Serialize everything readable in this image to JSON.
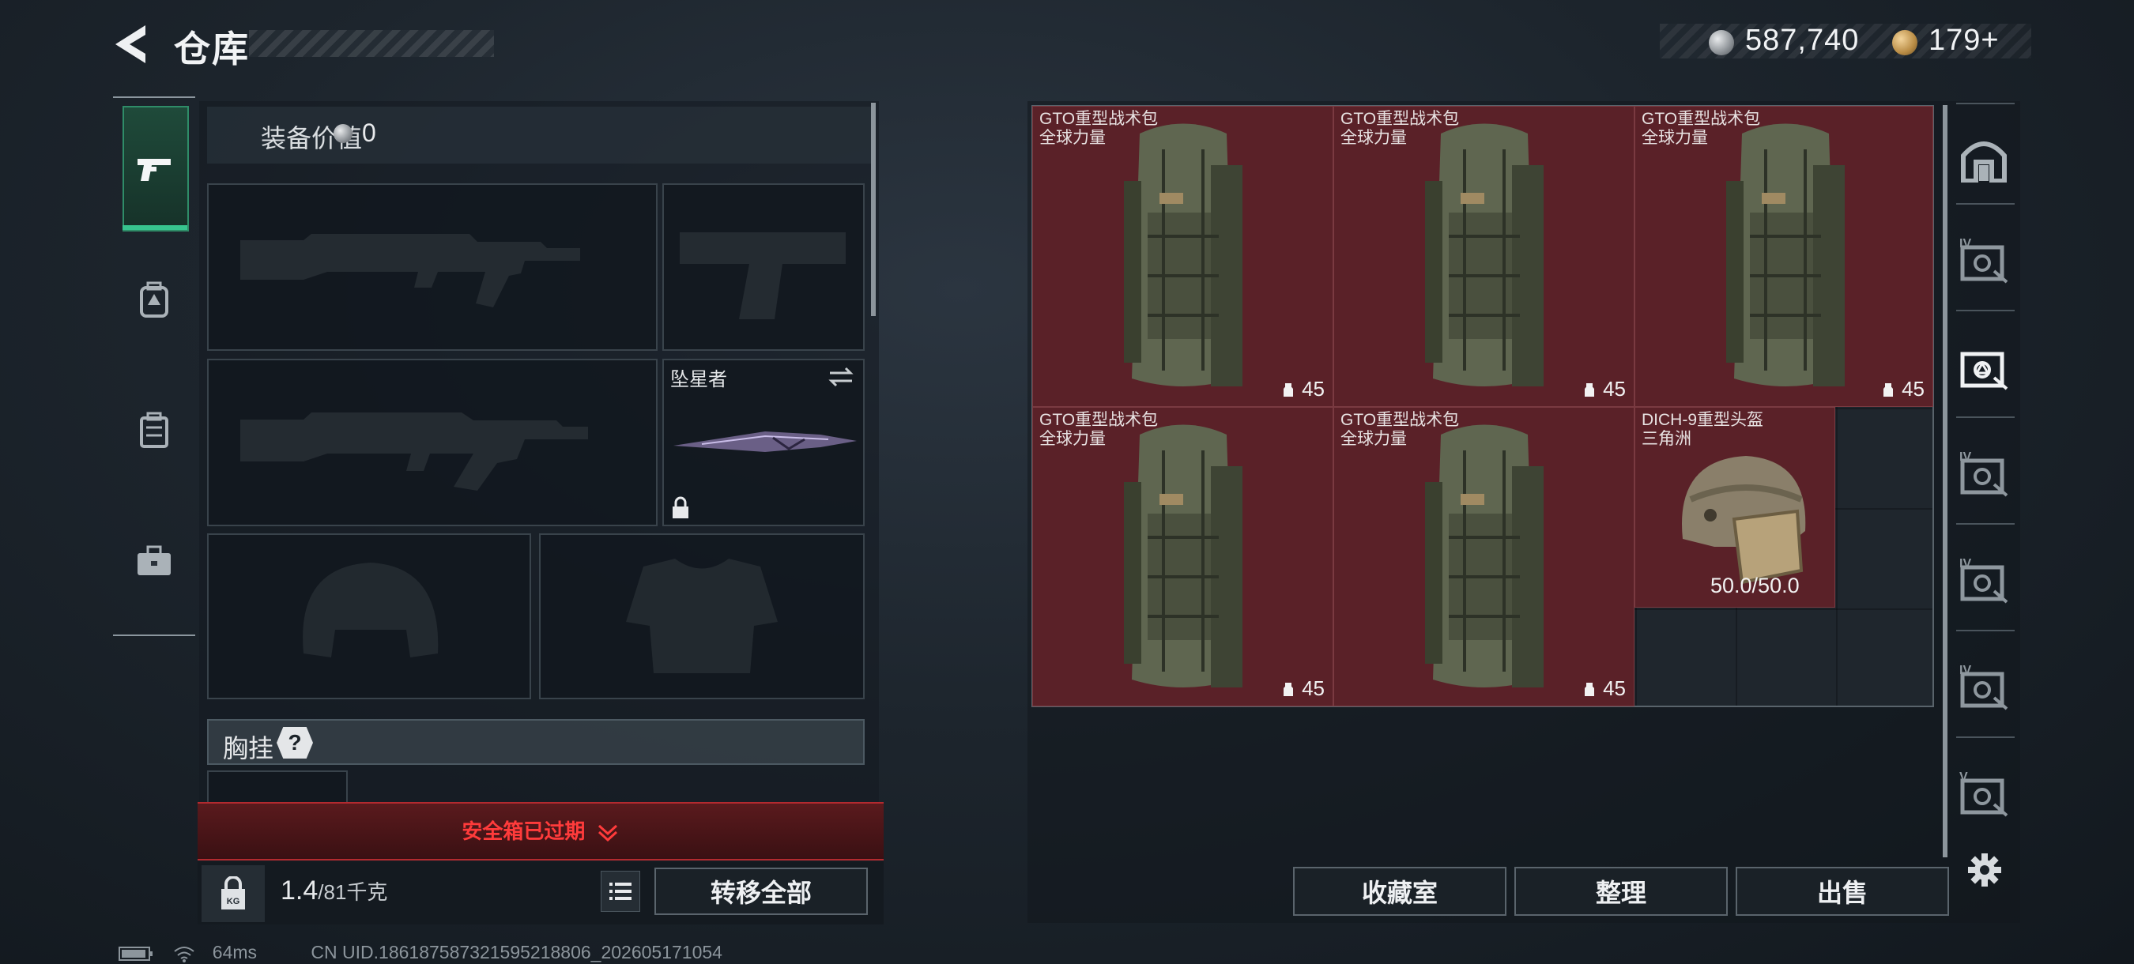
{
  "header": {
    "title": "仓库",
    "currency_silver": "587,740",
    "currency_gold": "179+"
  },
  "left_tabs": [
    {
      "icon": "pistol-icon",
      "active": true
    },
    {
      "icon": "backpack-icon",
      "active": false
    },
    {
      "icon": "case-icon",
      "active": false
    },
    {
      "icon": "briefcase-icon",
      "active": false
    }
  ],
  "loadout": {
    "equip_value_label": "装备价值",
    "equip_value": "0",
    "knife_name": "坠星者",
    "chest_rig_label": "胸挂",
    "help_label": "?",
    "safe_box_status": "安全箱已过期",
    "weight_current": "1.4",
    "weight_capacity": "/81千克",
    "transfer_all_label": "转移全部"
  },
  "stash_items": [
    {
      "name": "GTO重型战术包",
      "sub": "全球力量",
      "count": "45"
    },
    {
      "name": "GTO重型战术包",
      "sub": "全球力量",
      "count": "45"
    },
    {
      "name": "GTO重型战术包",
      "sub": "全球力量",
      "count": "45"
    },
    {
      "name": "GTO重型战术包",
      "sub": "全球力量",
      "count": "45"
    },
    {
      "name": "GTO重型战术包",
      "sub": "全球力量",
      "count": "45"
    },
    {
      "name": "DICH-9重型头盔",
      "sub": "三角洲",
      "durability": "50.0/50.0"
    }
  ],
  "stash_buttons": {
    "collection": "收藏室",
    "organize": "整理",
    "sell": "出售"
  },
  "right_tabs": [
    {
      "icon": "stash-home-icon",
      "tier": ""
    },
    {
      "icon": "storage-box-icon",
      "tier": "IV"
    },
    {
      "icon": "storage-box-icon",
      "tier": ""
    },
    {
      "icon": "storage-box-icon",
      "tier": "IV"
    },
    {
      "icon": "storage-box-icon",
      "tier": "IV"
    },
    {
      "icon": "storage-box-icon",
      "tier": "IV"
    },
    {
      "icon": "storage-box-icon",
      "tier": "V"
    }
  ],
  "status": {
    "ping": "64ms",
    "uid": "CN UID.18618758732159521​8806_202605171054"
  },
  "colors": {
    "accent_green": "#37c48e",
    "item_red": "#5a2128",
    "warning_red": "#ff3b3b"
  }
}
